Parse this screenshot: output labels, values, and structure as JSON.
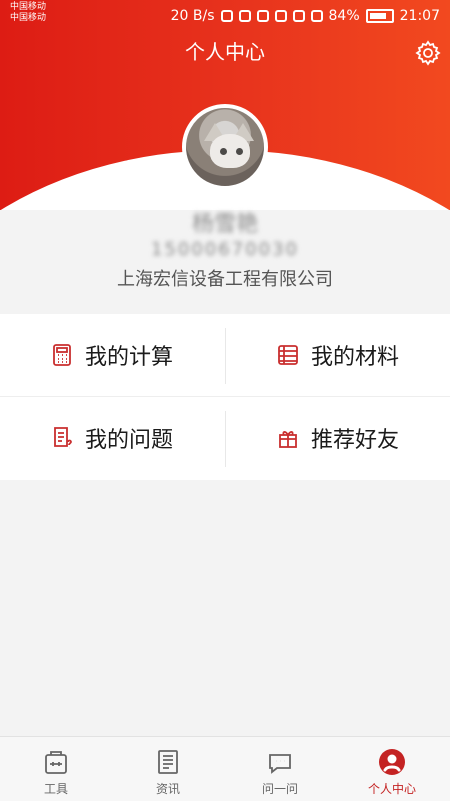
{
  "status": {
    "carrier_line1": "中国移动",
    "carrier_line2": "中国移动",
    "network_speed": "20 B/s",
    "battery": "84%",
    "time": "21:07"
  },
  "header": {
    "title": "个人中心"
  },
  "profile": {
    "name": "杨雪艳",
    "phone": "15000670030",
    "company": "上海宏信设备工程有限公司"
  },
  "menu": {
    "items": [
      {
        "label": "我的计算",
        "icon": "calculator-icon"
      },
      {
        "label": "我的材料",
        "icon": "materials-icon"
      },
      {
        "label": "我的问题",
        "icon": "question-document-icon"
      },
      {
        "label": "推荐好友",
        "icon": "gift-icon"
      }
    ]
  },
  "tabs": [
    {
      "label": "工具",
      "icon": "toolbox-icon"
    },
    {
      "label": "资讯",
      "icon": "news-icon"
    },
    {
      "label": "问一问",
      "icon": "chat-icon"
    },
    {
      "label": "个人中心",
      "icon": "profile-icon",
      "active": true
    }
  ],
  "colors": {
    "accent": "#c42323",
    "header_start": "#dd1c14",
    "header_end": "#f2491f"
  }
}
